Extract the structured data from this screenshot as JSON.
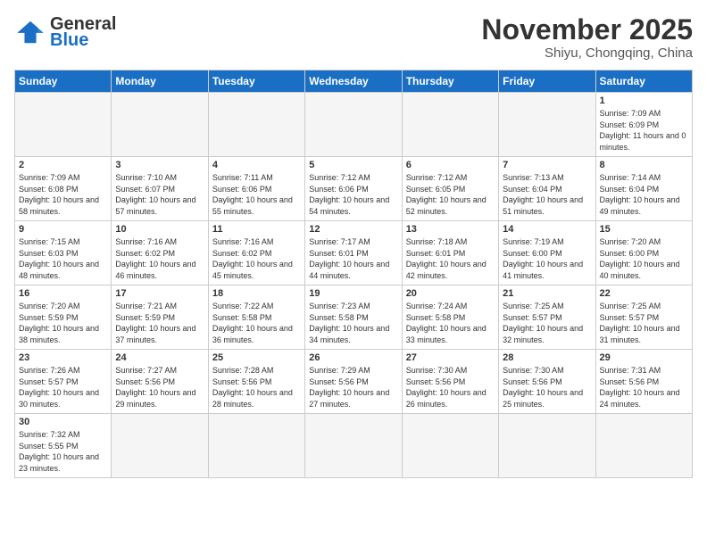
{
  "header": {
    "logo_general": "General",
    "logo_blue": "Blue",
    "month_title": "November 2025",
    "subtitle": "Shiyu, Chongqing, China"
  },
  "weekdays": [
    "Sunday",
    "Monday",
    "Tuesday",
    "Wednesday",
    "Thursday",
    "Friday",
    "Saturday"
  ],
  "weeks": [
    [
      {
        "day": "",
        "info": "",
        "empty": true
      },
      {
        "day": "",
        "info": "",
        "empty": true
      },
      {
        "day": "",
        "info": "",
        "empty": true
      },
      {
        "day": "",
        "info": "",
        "empty": true
      },
      {
        "day": "",
        "info": "",
        "empty": true
      },
      {
        "day": "",
        "info": "",
        "empty": true
      },
      {
        "day": "1",
        "info": "Sunrise: 7:09 AM\nSunset: 6:09 PM\nDaylight: 11 hours and 0 minutes."
      }
    ],
    [
      {
        "day": "2",
        "info": "Sunrise: 7:09 AM\nSunset: 6:08 PM\nDaylight: 10 hours and 58 minutes."
      },
      {
        "day": "3",
        "info": "Sunrise: 7:10 AM\nSunset: 6:07 PM\nDaylight: 10 hours and 57 minutes."
      },
      {
        "day": "4",
        "info": "Sunrise: 7:11 AM\nSunset: 6:06 PM\nDaylight: 10 hours and 55 minutes."
      },
      {
        "day": "5",
        "info": "Sunrise: 7:12 AM\nSunset: 6:06 PM\nDaylight: 10 hours and 54 minutes."
      },
      {
        "day": "6",
        "info": "Sunrise: 7:12 AM\nSunset: 6:05 PM\nDaylight: 10 hours and 52 minutes."
      },
      {
        "day": "7",
        "info": "Sunrise: 7:13 AM\nSunset: 6:04 PM\nDaylight: 10 hours and 51 minutes."
      },
      {
        "day": "8",
        "info": "Sunrise: 7:14 AM\nSunset: 6:04 PM\nDaylight: 10 hours and 49 minutes."
      }
    ],
    [
      {
        "day": "9",
        "info": "Sunrise: 7:15 AM\nSunset: 6:03 PM\nDaylight: 10 hours and 48 minutes."
      },
      {
        "day": "10",
        "info": "Sunrise: 7:16 AM\nSunset: 6:02 PM\nDaylight: 10 hours and 46 minutes."
      },
      {
        "day": "11",
        "info": "Sunrise: 7:16 AM\nSunset: 6:02 PM\nDaylight: 10 hours and 45 minutes."
      },
      {
        "day": "12",
        "info": "Sunrise: 7:17 AM\nSunset: 6:01 PM\nDaylight: 10 hours and 44 minutes."
      },
      {
        "day": "13",
        "info": "Sunrise: 7:18 AM\nSunset: 6:01 PM\nDaylight: 10 hours and 42 minutes."
      },
      {
        "day": "14",
        "info": "Sunrise: 7:19 AM\nSunset: 6:00 PM\nDaylight: 10 hours and 41 minutes."
      },
      {
        "day": "15",
        "info": "Sunrise: 7:20 AM\nSunset: 6:00 PM\nDaylight: 10 hours and 40 minutes."
      }
    ],
    [
      {
        "day": "16",
        "info": "Sunrise: 7:20 AM\nSunset: 5:59 PM\nDaylight: 10 hours and 38 minutes."
      },
      {
        "day": "17",
        "info": "Sunrise: 7:21 AM\nSunset: 5:59 PM\nDaylight: 10 hours and 37 minutes."
      },
      {
        "day": "18",
        "info": "Sunrise: 7:22 AM\nSunset: 5:58 PM\nDaylight: 10 hours and 36 minutes."
      },
      {
        "day": "19",
        "info": "Sunrise: 7:23 AM\nSunset: 5:58 PM\nDaylight: 10 hours and 34 minutes."
      },
      {
        "day": "20",
        "info": "Sunrise: 7:24 AM\nSunset: 5:58 PM\nDaylight: 10 hours and 33 minutes."
      },
      {
        "day": "21",
        "info": "Sunrise: 7:25 AM\nSunset: 5:57 PM\nDaylight: 10 hours and 32 minutes."
      },
      {
        "day": "22",
        "info": "Sunrise: 7:25 AM\nSunset: 5:57 PM\nDaylight: 10 hours and 31 minutes."
      }
    ],
    [
      {
        "day": "23",
        "info": "Sunrise: 7:26 AM\nSunset: 5:57 PM\nDaylight: 10 hours and 30 minutes."
      },
      {
        "day": "24",
        "info": "Sunrise: 7:27 AM\nSunset: 5:56 PM\nDaylight: 10 hours and 29 minutes."
      },
      {
        "day": "25",
        "info": "Sunrise: 7:28 AM\nSunset: 5:56 PM\nDaylight: 10 hours and 28 minutes."
      },
      {
        "day": "26",
        "info": "Sunrise: 7:29 AM\nSunset: 5:56 PM\nDaylight: 10 hours and 27 minutes."
      },
      {
        "day": "27",
        "info": "Sunrise: 7:30 AM\nSunset: 5:56 PM\nDaylight: 10 hours and 26 minutes."
      },
      {
        "day": "28",
        "info": "Sunrise: 7:30 AM\nSunset: 5:56 PM\nDaylight: 10 hours and 25 minutes."
      },
      {
        "day": "29",
        "info": "Sunrise: 7:31 AM\nSunset: 5:56 PM\nDaylight: 10 hours and 24 minutes."
      }
    ],
    [
      {
        "day": "30",
        "info": "Sunrise: 7:32 AM\nSunset: 5:55 PM\nDaylight: 10 hours and 23 minutes.",
        "last": true
      },
      {
        "day": "",
        "info": "",
        "empty": true,
        "last": true
      },
      {
        "day": "",
        "info": "",
        "empty": true,
        "last": true
      },
      {
        "day": "",
        "info": "",
        "empty": true,
        "last": true
      },
      {
        "day": "",
        "info": "",
        "empty": true,
        "last": true
      },
      {
        "day": "",
        "info": "",
        "empty": true,
        "last": true
      },
      {
        "day": "",
        "info": "",
        "empty": true,
        "last": true
      }
    ]
  ]
}
